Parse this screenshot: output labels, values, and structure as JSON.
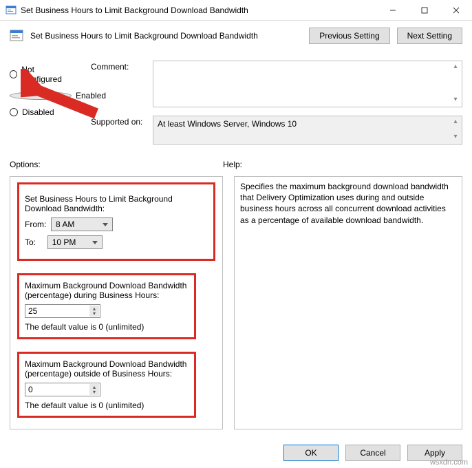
{
  "window": {
    "title": "Set Business Hours to Limit Background Download Bandwidth"
  },
  "header": {
    "title": "Set Business Hours to Limit Background Download Bandwidth",
    "prev": "Previous Setting",
    "next": "Next Setting"
  },
  "radios": {
    "not_configured": "Not Configured",
    "enabled": "Enabled",
    "disabled": "Disabled",
    "selected": "enabled"
  },
  "comment": {
    "label": "Comment:",
    "value": ""
  },
  "supported": {
    "label": "Supported on:",
    "value": "At least Windows Server, Windows 10"
  },
  "sections": {
    "options": "Options:",
    "help": "Help:"
  },
  "options": {
    "title": "Set Business Hours to Limit Background Download Bandwidth:",
    "from_label": "From:",
    "from_value": "8 AM",
    "to_label": "To:",
    "to_value": "10 PM",
    "during_label": "Maximum Background Download Bandwidth (percentage) during Business Hours:",
    "during_value": "25",
    "during_default": "The default value is 0 (unlimited)",
    "outside_label": "Maximum Background Download Bandwidth (percentage) outside of Business Hours:",
    "outside_value": "0",
    "outside_default": "The default value is 0 (unlimited)"
  },
  "help": {
    "text": "Specifies the maximum background download bandwidth that Delivery Optimization uses during and outside business hours across all concurrent download activities as a percentage of available download bandwidth."
  },
  "footer": {
    "ok": "OK",
    "cancel": "Cancel",
    "apply": "Apply"
  },
  "watermark": "wsxdn.com"
}
